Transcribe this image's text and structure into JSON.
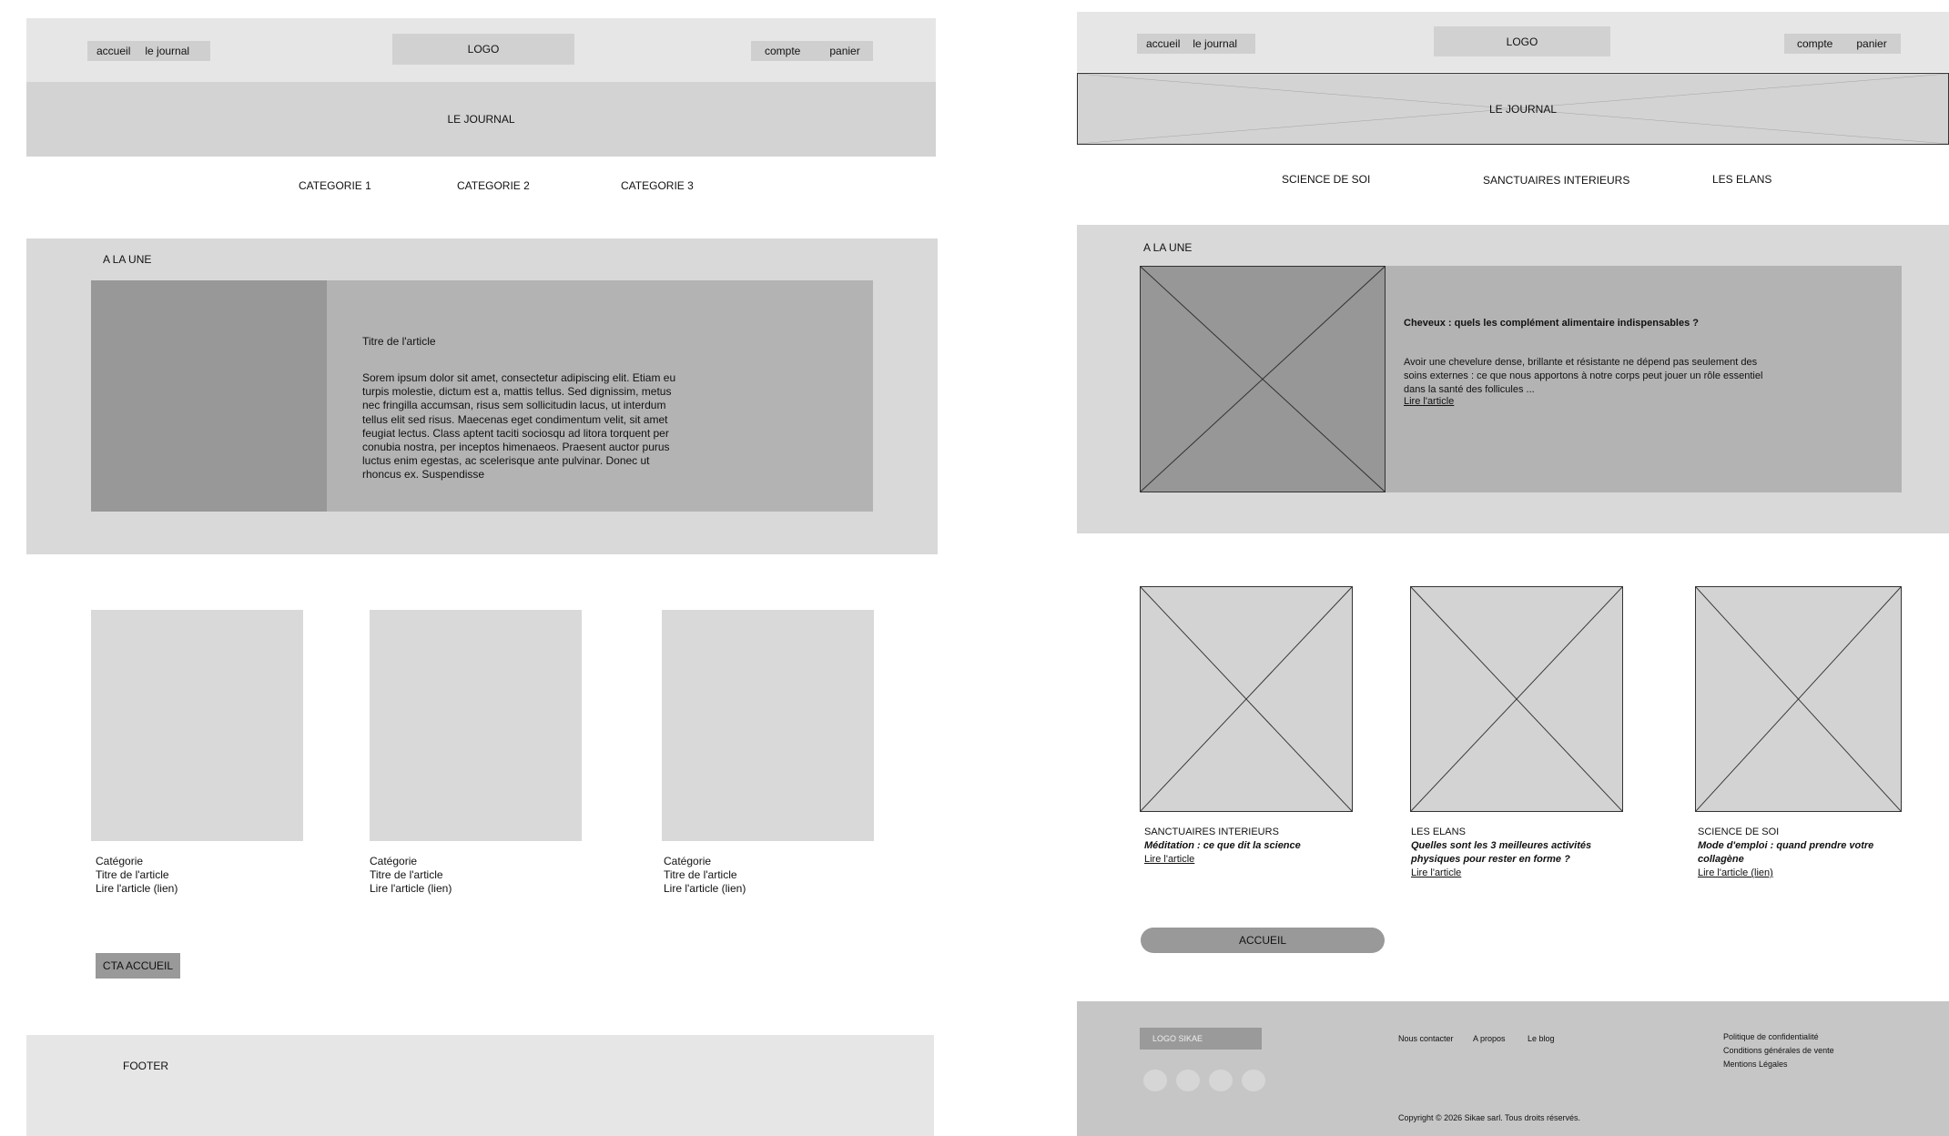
{
  "left": {
    "nav": {
      "home": "accueil",
      "journal": "le journal",
      "logo": "LOGO",
      "account": "compte",
      "cart": "panier"
    },
    "banner_title": "LE JOURNAL",
    "categories": [
      "CATEGORIE 1",
      "CATEGORIE 2",
      "CATEGORIE 3"
    ],
    "featured": {
      "section_title": "A LA UNE",
      "article_title": "Titre de l'article",
      "body": "Sorem ipsum dolor sit amet, consectetur adipiscing elit. Etiam eu turpis molestie, dictum est a, mattis tellus. Sed dignissim, metus nec fringilla accumsan, risus sem sollicitudin lacus, ut interdum tellus elit sed risus. Maecenas eget condimentum velit, sit amet feugiat lectus. Class aptent taciti sociosqu ad litora torquent per conubia nostra, per inceptos himenaeos. Praesent auctor purus luctus enim egestas, ac scelerisque ante pulvinar. Donec ut rhoncus ex. Suspendisse"
    },
    "cards": [
      {
        "category": "Catégorie",
        "title": "Titre de l'article",
        "link": "Lire l'article (lien)"
      },
      {
        "category": "Catégorie",
        "title": "Titre de l'article",
        "link": "Lire l'article (lien)"
      },
      {
        "category": "Catégorie",
        "title": "Titre de l'article",
        "link": "Lire l'article (lien)"
      }
    ],
    "cta": "CTA ACCUEIL",
    "footer": "FOOTER"
  },
  "right": {
    "nav": {
      "home": "accueil",
      "journal": "le journal",
      "logo": "LOGO",
      "account": "compte",
      "cart": "panier"
    },
    "banner_title": "LE JOURNAL",
    "categories": [
      "SCIENCE DE SOI",
      "SANCTUAIRES INTERIEURS",
      "LES ELANS"
    ],
    "featured": {
      "section_title": "A LA UNE",
      "article_title": "Cheveux : quels les complément alimentaire indispensables ?",
      "body": "Avoir une chevelure dense, brillante et résistante ne dépend pas seulement des soins externes : ce que nous apportons à notre corps peut jouer un rôle essentiel dans la santé des follicules ...",
      "link": "Lire l'article"
    },
    "cards": [
      {
        "category": "SANCTUAIRES INTERIEURS",
        "title": "Méditation : ce que dit la science",
        "link": "Lire l'article"
      },
      {
        "category": "LES ELANS",
        "title": "Quelles sont les 3 meilleures activités physiques pour rester en forme ?",
        "link": "Lire l'article"
      },
      {
        "category": "SCIENCE DE SOI",
        "title": "Mode d'emploi : quand prendre votre collagène",
        "link": "Lire l'article (lien)"
      }
    ],
    "cta": "ACCUEIL",
    "footer": {
      "logo": "LOGO SIKAE",
      "links": [
        "Nous contacter",
        "A propos",
        "Le blog"
      ],
      "legal": [
        "Politique de confidentialité",
        "Conditions générales de vente",
        "Mentions Légales"
      ],
      "copyright": "Copyright © 2026 Sikae sarl. Tous droits réservés."
    }
  }
}
